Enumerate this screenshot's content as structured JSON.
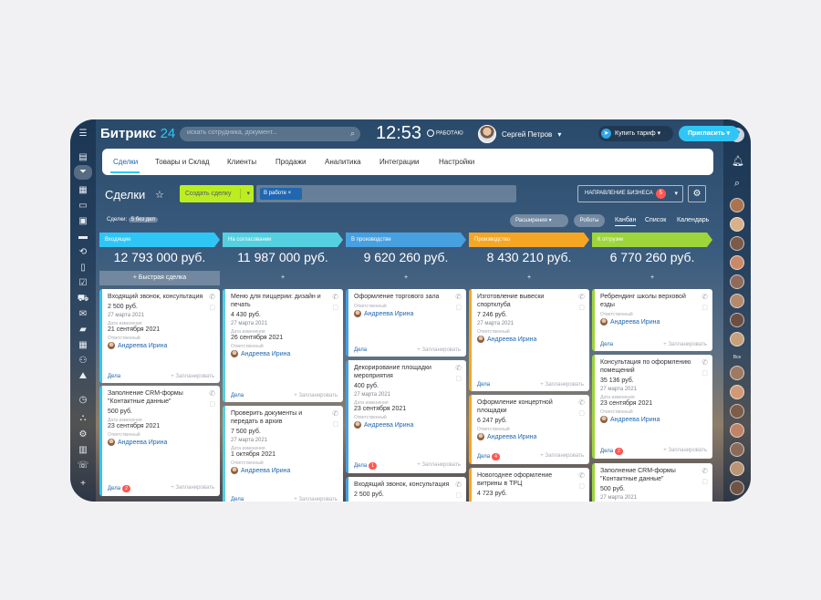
{
  "topbar": {
    "logo_name": "Битрикс",
    "logo_num": "24",
    "search_placeholder": "искать сотрудника, документ...",
    "time": "12:53",
    "work_status": "РАБОТАЮ",
    "user_name": "Сергей Петров",
    "buy_tariff": "Купить тариф",
    "invite": "Пригласить"
  },
  "nav": {
    "tabs": [
      "Сделки",
      "Товары и Склад",
      "Клиенты",
      "Продажи",
      "Аналитика",
      "Интеграции",
      "Настройки"
    ]
  },
  "toolbar": {
    "title": "Сделки",
    "create_deal": "Создать сделку",
    "filter_chip": "В работе",
    "direction": "НАПРАВЛЕНИЕ БИЗНЕСА",
    "direction_count": "5",
    "deals_label": "Сделки:",
    "deals_badge": "5 без дел",
    "extensions": "Расширения",
    "robots": "Роботы",
    "views": [
      "Канбан",
      "Список",
      "Календарь"
    ]
  },
  "right_rail": {
    "all_label": "Все"
  },
  "columns": [
    {
      "stage": "Входящие",
      "color": "#2fc6f6",
      "sum": "12 793 000 руб.",
      "quick": "+ Быстрая сделка",
      "cards": [
        {
          "title": "Входящий звонок, консультация",
          "price": "2 500 руб.",
          "date": "27 марта 2021",
          "due_label": "Дата изменения",
          "due": "21 сентября 2021",
          "resp_label": "Ответственный",
          "resp": "Андреева Ирина",
          "deals": "Дела",
          "plan": "+ Запланировать",
          "badge": ""
        },
        {
          "title": "Заполнение CRM-формы \"Контактные данные\"",
          "price": "500 руб.",
          "date": "",
          "due_label": "Дата изменения",
          "due": "23 сентября 2021",
          "resp_label": "Ответственный",
          "resp": "Андреева Ирина",
          "deals": "Дела",
          "plan": "+ Запланировать",
          "badge": "2"
        }
      ]
    },
    {
      "stage": "На согласовании",
      "color": "#55d0e0",
      "sum": "11 987 000 руб.",
      "quick": "+",
      "cards": [
        {
          "title": "Меню для пиццерии: дизайн и печать",
          "price": "4 430 руб.",
          "date": "27 марта 2021",
          "due_label": "Дата изменения",
          "due": "26 сентября 2021",
          "resp_label": "Ответственный",
          "resp": "Андреева Ирина",
          "deals": "Дела",
          "plan": "+ Запланировать",
          "badge": ""
        },
        {
          "title": "Проверить документы и передать в архив",
          "price": "7 500 руб.",
          "date": "27 марта 2021",
          "due_label": "Дата изменения",
          "due": "1 октября 2021",
          "resp_label": "Ответственный",
          "resp": "Андреева Ирина",
          "deals": "Дела",
          "plan": "+ Запланировать",
          "badge": ""
        }
      ]
    },
    {
      "stage": "В производстве",
      "color": "#47a0e0",
      "sum": "9 620 260 руб.",
      "quick": "+",
      "cards": [
        {
          "title": "Оформление торгового зала",
          "price": "",
          "date": "",
          "due_label": "",
          "due": "",
          "resp_label": "Ответственный",
          "resp": "Андреева Ирина",
          "deals": "Дела",
          "plan": "+ Запланировать",
          "badge": ""
        },
        {
          "title": "Декорирование площадки мероприятия",
          "price": "400 руб.",
          "date": "27 марта 2021",
          "due_label": "Дата изменения",
          "due": "23 сентября 2021",
          "resp_label": "Ответственный",
          "resp": "Андреева Ирина",
          "deals": "Дела",
          "plan": "+ Запланировать",
          "badge": "1"
        },
        {
          "title": "Входящий звонок, консультация",
          "price": "2 500 руб.",
          "date": "",
          "due_label": "",
          "due": "",
          "resp_label": "",
          "resp": "",
          "deals": "",
          "plan": "",
          "badge": ""
        }
      ]
    },
    {
      "stage": "Производство",
      "color": "#f5a623",
      "sum": "8 430 210 руб.",
      "quick": "+",
      "cards": [
        {
          "title": "Изготовление вывески спортклуба",
          "price": "7 246 руб.",
          "date": "27 марта 2021",
          "due_label": "",
          "due": "",
          "resp_label": "Ответственный",
          "resp": "Андреева Ирина",
          "deals": "Дела",
          "plan": "+ Запланировать",
          "badge": ""
        },
        {
          "title": "Оформление концертной площадки",
          "price": "6 247 руб.",
          "date": "",
          "due_label": "",
          "due": "",
          "resp_label": "Ответственный",
          "resp": "Андреева Ирина",
          "deals": "Дела",
          "plan": "+ Запланировать",
          "badge": "4"
        },
        {
          "title": "Новогоднее оформление витрины в ТРЦ",
          "price": "4 723 руб.",
          "date": "",
          "due_label": "",
          "due": "",
          "resp_label": "",
          "resp": "",
          "deals": "",
          "plan": "",
          "badge": ""
        }
      ]
    },
    {
      "stage": "К отгрузке",
      "color": "#9dd53a",
      "sum": "6 770 260 руб.",
      "quick": "+",
      "cards": [
        {
          "title": "Ребрендинг школы верховой езды",
          "price": "",
          "date": "",
          "due_label": "",
          "due": "",
          "resp_label": "Ответственный",
          "resp": "Андреева Ирина",
          "deals": "Дела",
          "plan": "+ Запланировать",
          "badge": ""
        },
        {
          "title": "Консультация по оформлению помещений",
          "price": "35 136 руб.",
          "date": "27 марта 2021",
          "due_label": "Дата изменения",
          "due": "23 сентября 2021",
          "resp_label": "Ответственный",
          "resp": "Андреева Ирина",
          "deals": "Дела",
          "plan": "+ Запланировать",
          "badge": "2"
        },
        {
          "title": "Заполнение CRM-формы \"Контактные данные\"",
          "price": "500 руб.",
          "date": "27 марта 2021",
          "due_label": "",
          "due": "",
          "resp_label": "",
          "resp": "",
          "deals": "",
          "plan": "",
          "badge": ""
        }
      ]
    }
  ]
}
